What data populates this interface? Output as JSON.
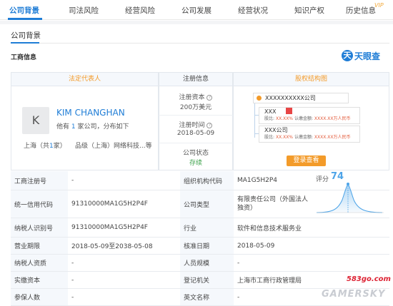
{
  "nav": {
    "tabs": [
      "公司背景",
      "司法风险",
      "经营风险",
      "公司发展",
      "经营状况",
      "知识产权",
      "历史信息"
    ],
    "active": 0,
    "vip": "VIP",
    "accent": "#1f7dd6"
  },
  "section": {
    "title": "公司背景",
    "subtitle": "工商信息",
    "brand_mark": "天",
    "brand_text": "天眼查"
  },
  "card": {
    "legal_rep_header": "法定代表人",
    "reg_info_header": "注册信息",
    "equity_header": "股权结构图",
    "avatar_initial": "K",
    "person_name": "KIM CHANGHAN",
    "person_desc_prefix": "他有",
    "person_desc_count": "1",
    "person_desc_suffix": "家公司，分布如下",
    "location_prefix": "上海（共",
    "location_count": "1",
    "location_suffix": "家）",
    "brand_location": "品级（上海）网络科技...等",
    "reg_capital_label": "注册资本",
    "reg_capital_value": "200万美元",
    "reg_time_label": "注册时间",
    "reg_time_value": "2018-05-09",
    "status_label": "公司状态",
    "status_value": "存续",
    "status_color": "#3fa34d"
  },
  "equity": {
    "company": "XXXXXXXXXX公司",
    "holders": [
      {
        "name": "XXX",
        "ratio_label": "股比:",
        "ratio": "XX.XX%",
        "amount_label": "认缴金额:",
        "amount": "XXXX.XX万人民币"
      },
      {
        "name": "XXX公司",
        "ratio_label": "股比:",
        "ratio": "XX.XX%",
        "amount_label": "认缴金额:",
        "amount": "XXXX.XX万人民币"
      }
    ],
    "login_button": "登录查看"
  },
  "details": {
    "rows": [
      {
        "l1": "工商注册号",
        "v1": "-",
        "l2": "组织机构代码",
        "v2": "MA1G5H2P4"
      },
      {
        "l1": "统一信用代码",
        "v1": "91310000MA1G5H2P4F",
        "l2": "公司类型",
        "v2": "有限责任公司（外国法人独资）"
      },
      {
        "l1": "纳税人识别号",
        "v1": "91310000MA1G5H2P4F",
        "l2": "行业",
        "v2": "软件和信息技术服务业"
      },
      {
        "l1": "营业期限",
        "v1": "2018-05-09至2038-05-08",
        "l2": "核准日期",
        "v2": "2018-05-09"
      },
      {
        "l1": "纳税人资质",
        "v1": "-",
        "l2": "人员规模",
        "v2": "-"
      },
      {
        "l1": "实缴资本",
        "v1": "-",
        "l2": "登记机关",
        "v2": "上海市工商行政管理局"
      },
      {
        "l1": "参保人数",
        "v1": "-",
        "l2": "英文名称",
        "v2": "-"
      }
    ],
    "score_label": "评分",
    "score_value": "74"
  },
  "watermark": {
    "site": "583go.com",
    "brand": "GAMERSKY"
  }
}
